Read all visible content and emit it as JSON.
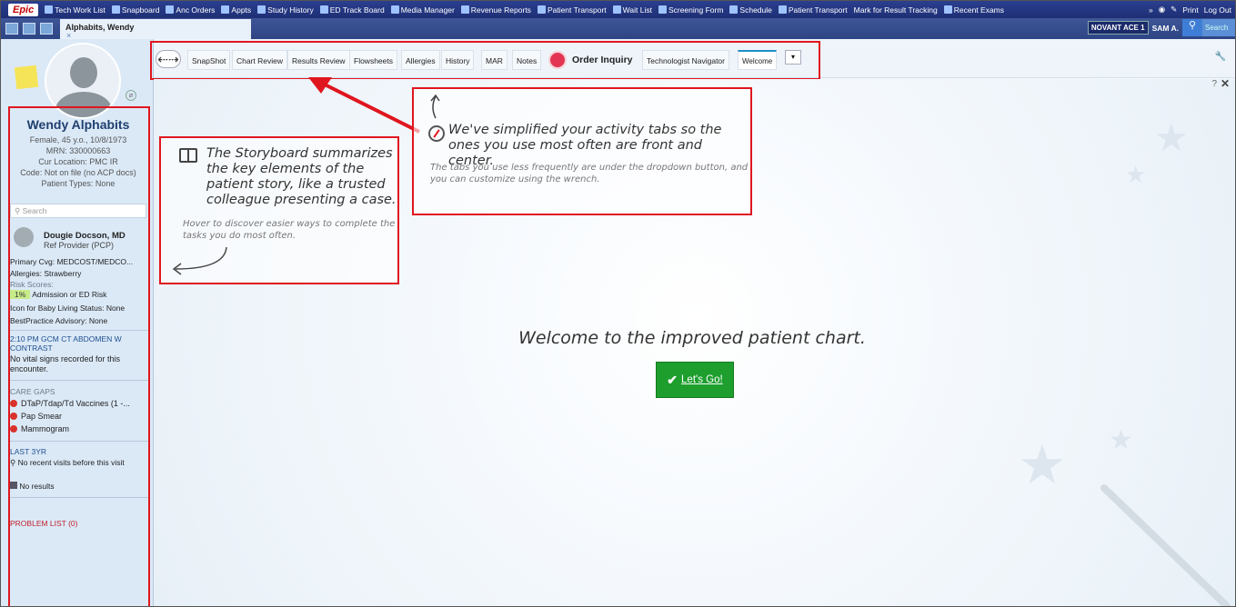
{
  "topbar": {
    "logo": "Epic",
    "items": [
      "Tech Work List",
      "Snapboard",
      "Anc Orders",
      "Appts",
      "Study History",
      "ED Track Board",
      "Media Manager",
      "Revenue Reports",
      "Patient Transport",
      "Wait List",
      "Screening Form",
      "Schedule",
      "Patient Transport",
      "Mark for Result Tracking",
      "Recent Exams"
    ],
    "print": "Print",
    "logout": "Log Out"
  },
  "patient_tab": {
    "label": "Alphabits, Wendy",
    "close": "×"
  },
  "header_right": {
    "department": "NOVANT ACE 1",
    "user": "SAM A.",
    "search_placeholder": "Search"
  },
  "sidebar": {
    "name": "Wendy Alphabits",
    "demographics": "Female, 45 y.o., 10/8/1973",
    "mrn": "MRN: 330000663",
    "location": "Cur Location: PMC IR",
    "code": "Code: Not on file (no ACP docs)",
    "patient_types": "Patient Types: None",
    "search_placeholder": "Search",
    "provider_name": "Dougie Docson, MD",
    "provider_role": "Ref Provider (PCP)",
    "primary_cvg": "Primary Cvg: MEDCOST/MEDCO...",
    "allergies": "Allergies: Strawberry",
    "risk_label": "Risk Scores:",
    "risk_value": "1%",
    "risk_text": "Admission or ED Risk",
    "baby_icon": "Icon for Baby Living Status: None",
    "bpa": "BestPractice Advisory: None",
    "encounter_title": "2:10 PM GCM CT ABDOMEN W CONTRAST",
    "encounter_note": "No vital signs recorded for this encounter.",
    "care_gaps_title": "CARE GAPS",
    "care_gaps": [
      "DTaP/Tdap/Td Vaccines (1 -...",
      "Pap Smear",
      "Mammogram"
    ],
    "last3yr_title": "LAST 3YR",
    "last3yr_visits": "No recent visits before this visit",
    "last3yr_results": "No results",
    "problem_list": "PROBLEM LIST (0)"
  },
  "tabs": [
    "SnapShot",
    "Chart Review",
    "Results Review",
    "Flowsheets",
    "Allergies",
    "History",
    "MAR",
    "Notes",
    "Order Inquiry",
    "Technologist Navigator",
    "Welcome"
  ],
  "callout_storyboard": {
    "main": "The Storyboard summarizes the key elements of the patient story, like a trusted colleague presenting a case.",
    "sub": "Hover to discover easier ways to complete the tasks you do most often."
  },
  "callout_tabs": {
    "main": "We've simplified your activity tabs so the ones you use most often are front and center.",
    "sub": "The tabs you use less frequently are under the dropdown button, and you can customize using the wrench."
  },
  "welcome_text": "Welcome to the improved patient chart.",
  "lets_go": "Let's Go!"
}
